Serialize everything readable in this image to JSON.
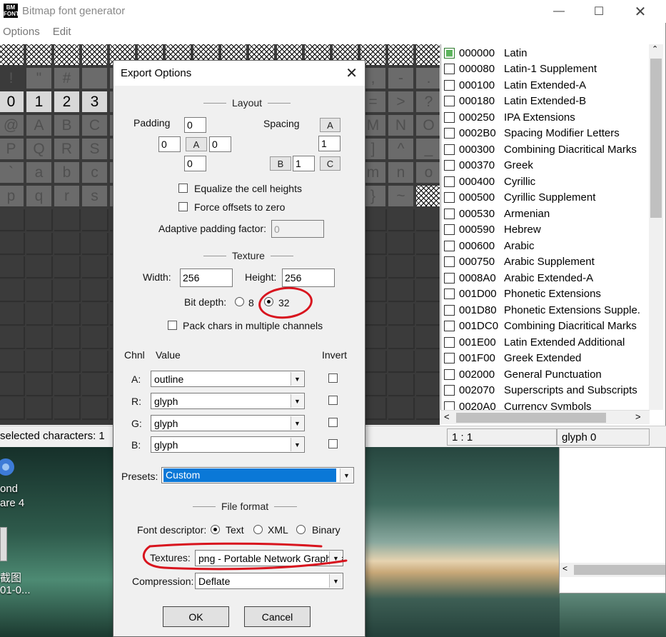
{
  "window": {
    "title": "Bitmap font generator",
    "icon_text": "BM FONT",
    "menu": [
      "Options",
      "Edit"
    ]
  },
  "grid": {
    "row1": [
      "!",
      "\"",
      "#",
      "",
      "",
      "",
      "",
      "",
      "",
      "",
      "",
      "",
      "",
      ",",
      "-",
      ".",
      "/"
    ],
    "row2": [
      "0",
      "1",
      "2",
      "3",
      "",
      "",
      "",
      "",
      "",
      "",
      "",
      "",
      "",
      "=",
      ">",
      "?"
    ],
    "row3": [
      "@",
      "A",
      "B",
      "C",
      "",
      "",
      "",
      "",
      "",
      "",
      "",
      "",
      "",
      "M",
      "N",
      "O"
    ],
    "row4": [
      "P",
      "Q",
      "R",
      "S",
      "",
      "",
      "",
      "",
      "",
      "",
      "",
      "",
      "",
      "]",
      "^",
      "_"
    ],
    "row5": [
      "`",
      "a",
      "b",
      "c",
      "",
      "",
      "",
      "",
      "",
      "",
      "",
      "",
      "",
      "m",
      "n",
      "o"
    ],
    "row6": [
      "p",
      "q",
      "r",
      "s",
      "",
      "",
      "",
      "",
      "",
      "",
      "",
      "",
      "",
      "}",
      "~",
      ""
    ]
  },
  "char_ranges": [
    {
      "code": "000000",
      "name": "Latin",
      "state": "partial"
    },
    {
      "code": "000080",
      "name": "Latin-1 Supplement",
      "state": "off"
    },
    {
      "code": "000100",
      "name": "Latin Extended-A",
      "state": "off"
    },
    {
      "code": "000180",
      "name": "Latin Extended-B",
      "state": "off"
    },
    {
      "code": "000250",
      "name": "IPA Extensions",
      "state": "off"
    },
    {
      "code": "0002B0",
      "name": "Spacing Modifier Letters",
      "state": "off"
    },
    {
      "code": "000300",
      "name": "Combining Diacritical Marks",
      "state": "off"
    },
    {
      "code": "000370",
      "name": "Greek",
      "state": "off"
    },
    {
      "code": "000400",
      "name": "Cyrillic",
      "state": "off"
    },
    {
      "code": "000500",
      "name": "Cyrillic Supplement",
      "state": "off"
    },
    {
      "code": "000530",
      "name": "Armenian",
      "state": "off"
    },
    {
      "code": "000590",
      "name": "Hebrew",
      "state": "off"
    },
    {
      "code": "000600",
      "name": "Arabic",
      "state": "off"
    },
    {
      "code": "000750",
      "name": "Arabic Supplement",
      "state": "off"
    },
    {
      "code": "0008A0",
      "name": "Arabic Extended-A",
      "state": "off"
    },
    {
      "code": "001D00",
      "name": "Phonetic Extensions",
      "state": "off"
    },
    {
      "code": "001D80",
      "name": "Phonetic Extensions Supple.",
      "state": "off"
    },
    {
      "code": "001DC0",
      "name": "Combining Diacritical Marks",
      "state": "off"
    },
    {
      "code": "001E00",
      "name": "Latin Extended Additional",
      "state": "off"
    },
    {
      "code": "001F00",
      "name": "Greek Extended",
      "state": "off"
    },
    {
      "code": "002000",
      "name": "General Punctuation",
      "state": "off"
    },
    {
      "code": "002070",
      "name": "Superscripts and Subscripts",
      "state": "off"
    },
    {
      "code": "0020A0",
      "name": "Currency Symbols",
      "state": "off"
    }
  ],
  "status": {
    "selected": "selected characters: 1",
    "scale": "1 : 1",
    "glyph": "glyph 0"
  },
  "desktop": {
    "icon1_label_a": "ond",
    "icon1_label_b": "are 4",
    "icon2_label_a": "截图",
    "icon2_label_b": "01-0..."
  },
  "dialog": {
    "title": "Export Options",
    "layout": {
      "heading": "Layout",
      "padding_label": "Padding",
      "spacing_label": "Spacing",
      "padding_up": "0",
      "padding_left": "0",
      "padding_right": "0",
      "padding_down": "0",
      "padding_btn": "A",
      "spacing_btn_a": "A",
      "spacing_horiz": "1",
      "spacing_btn_b": "B",
      "spacing_vert": "1",
      "spacing_btn_c": "C",
      "equalize_label": "Equalize the cell heights",
      "force_offsets_label": "Force offsets to zero",
      "adaptive_label": "Adaptive padding factor:",
      "adaptive_value": "0"
    },
    "texture": {
      "heading": "Texture",
      "width_label": "Width:",
      "width_value": "256",
      "height_label": "Height:",
      "height_value": "256",
      "bitdepth_label": "Bit depth:",
      "bit8": "8",
      "bit32": "32",
      "pack_label": "Pack chars in multiple channels"
    },
    "channels": {
      "chnl_header": "Chnl",
      "value_header": "Value",
      "invert_header": "Invert",
      "rows": [
        {
          "ch": "A:",
          "value": "outline"
        },
        {
          "ch": "R:",
          "value": "glyph"
        },
        {
          "ch": "G:",
          "value": "glyph"
        },
        {
          "ch": "B:",
          "value": "glyph"
        }
      ]
    },
    "presets_label": "Presets:",
    "presets_value": "Custom",
    "file_format": {
      "heading": "File format",
      "descriptor_label": "Font descriptor:",
      "opt_text": "Text",
      "opt_xml": "XML",
      "opt_binary": "Binary",
      "textures_label": "Textures:",
      "textures_value": "png - Portable Network Graphics",
      "compression_label": "Compression:",
      "compression_value": "Deflate"
    },
    "ok": "OK",
    "cancel": "Cancel"
  },
  "colors": {
    "selection_blue": "#0a78d7",
    "annotation_red": "#d8141e"
  }
}
